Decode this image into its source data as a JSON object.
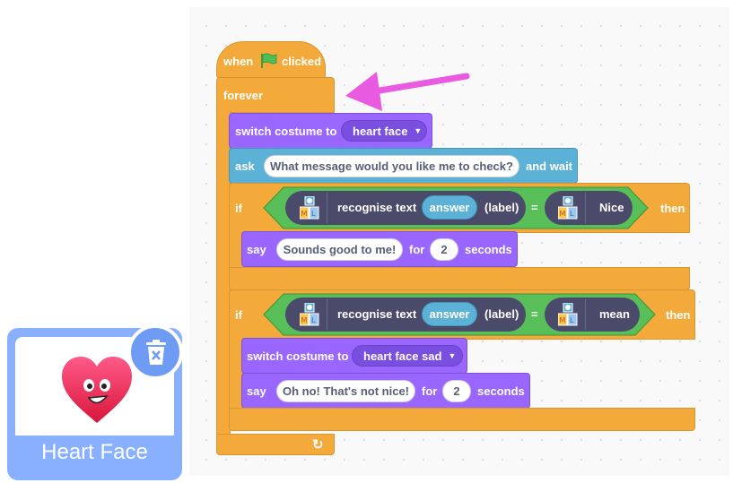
{
  "sprite_card": {
    "name": "Heart Face",
    "delete_icon": "trash-icon"
  },
  "script": {
    "hat": {
      "prefix": "when",
      "icon": "green-flag-icon",
      "suffix": "clicked"
    },
    "forever_label": "forever",
    "loop_arrow_icon": "loop-arrow-icon",
    "switch1": {
      "label": "switch costume to",
      "costume": "heart face"
    },
    "ask": {
      "label": "ask",
      "question": "What message would you like me to check?",
      "suffix": "and wait"
    },
    "if1": {
      "if_label": "if",
      "recognise_label": "recognise text",
      "answer_label": "answer",
      "label_suffix": "(label)",
      "equals": "=",
      "value": "Nice",
      "then_label": "then",
      "say": {
        "label": "say",
        "message": "Sounds good to me!",
        "for_label": "for",
        "seconds_value": "2",
        "seconds_label": "seconds"
      }
    },
    "if2": {
      "if_label": "if",
      "recognise_label": "recognise text",
      "answer_label": "answer",
      "label_suffix": "(label)",
      "equals": "=",
      "value": "mean",
      "then_label": "then",
      "switch": {
        "label": "switch costume to",
        "costume": "heart face sad"
      },
      "say": {
        "label": "say",
        "message": "Oh no! That's not nice!",
        "for_label": "for",
        "seconds_value": "2",
        "seconds_label": "seconds"
      }
    }
  },
  "annotation": {
    "arrow_color": "#e85be0"
  },
  "colors": {
    "control": "#f4aa3a",
    "looks": "#9966ff",
    "sensing": "#5cb1d6",
    "operators": "#59c059",
    "ml_reporter": "#4a4a6a"
  }
}
